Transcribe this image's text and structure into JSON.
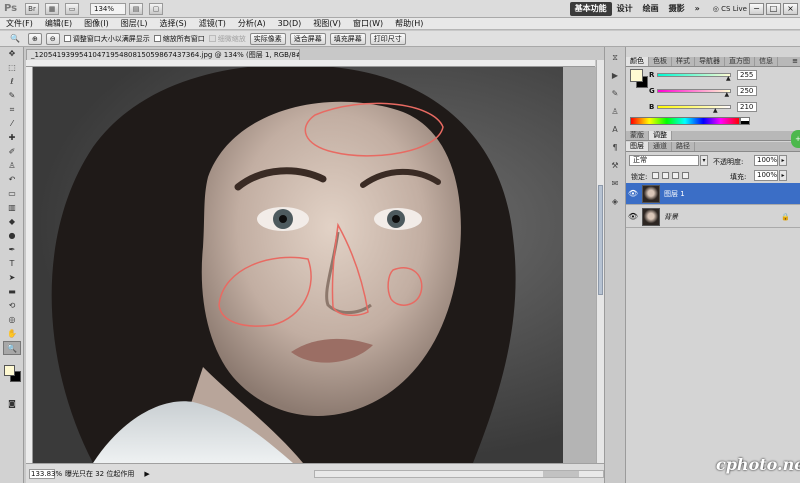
{
  "appbar": {
    "logo": "Ps",
    "zoom": "134%",
    "workspaces": [
      "基本功能",
      "设计",
      "绘画",
      "摄影"
    ],
    "more": "»",
    "cs_live": "CS Live",
    "win_controls": [
      "−",
      "□",
      "×"
    ]
  },
  "menus": [
    "文件(F)",
    "编辑(E)",
    "图像(I)",
    "图层(L)",
    "选择(S)",
    "滤镜(T)",
    "分析(A)",
    "3D(D)",
    "视图(V)",
    "窗口(W)",
    "帮助(H)"
  ],
  "options": {
    "resize_windows": "调整窗口大小以满屏显示",
    "zoom_all": "缩放所有窗口",
    "scrubby": "细微缩放",
    "actual_pixels": "实际像素",
    "fit_screen": "适合屏幕",
    "fill_screen": "填充屏幕",
    "print_size": "打印尺寸"
  },
  "document": {
    "tab_title": "_1205419399541047195480815059867437364.jpg @ 134% (图层 1, RGB/8#) *",
    "close": "×"
  },
  "status": {
    "zoom": "133.83%",
    "info": "曝光只在 32 位起作用"
  },
  "colors": {
    "foreground": "#fffad2",
    "accent": "#3b6ec6"
  },
  "color_panel": {
    "tabs": [
      "颜色",
      "色板",
      "样式",
      "导航器",
      "直方图",
      "信息"
    ],
    "channels": [
      {
        "label": "R",
        "value": "255",
        "level": 1.0
      },
      {
        "label": "G",
        "value": "250",
        "level": 0.98
      },
      {
        "label": "B",
        "value": "210",
        "level": 0.82
      }
    ]
  },
  "adjust_tabs": [
    "蒙版",
    "调整"
  ],
  "layers_panel": {
    "tabs": [
      "图层",
      "通道",
      "路径"
    ],
    "blend_mode": "正常",
    "opacity_label": "不透明度:",
    "opacity": "100%",
    "lock_label": "锁定:",
    "fill_label": "填充:",
    "fill": "100%",
    "layers": [
      {
        "name": "图层 1",
        "selected": true
      },
      {
        "name": "背景",
        "selected": false
      }
    ]
  },
  "green_button": "+",
  "watermark": "cphoto.net"
}
